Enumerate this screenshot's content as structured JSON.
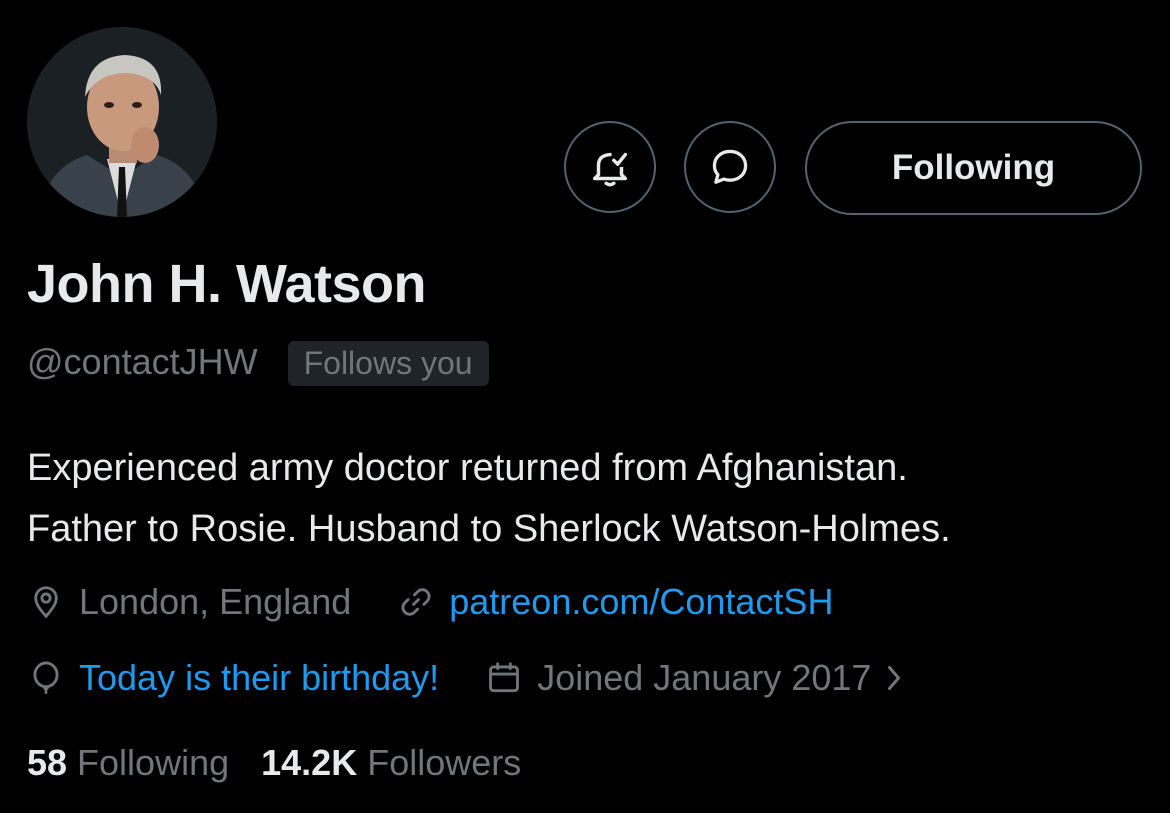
{
  "profile": {
    "display_name": "John H. Watson",
    "handle": "@contactJHW",
    "follows_you_badge": "Follows you",
    "bio_line1": "Experienced army doctor returned from Afghanistan.",
    "bio_line2": "Father to Rosie. Husband to Sherlock Watson-Holmes.",
    "location": "London, England",
    "website": "patreon.com/ContactSH",
    "birthday_text": "Today is their birthday!",
    "joined_text": "Joined January 2017"
  },
  "actions": {
    "notify_icon": "bell-check-icon",
    "message_icon": "message-bubble-icon",
    "following_label": "Following"
  },
  "stats": {
    "following_count": "58",
    "following_label": "Following",
    "followers_count": "14.2K",
    "followers_label": "Followers"
  },
  "colors": {
    "background": "#000000",
    "primary_text": "#e7e9ea",
    "secondary_text": "#71767b",
    "link": "#1d9bf0",
    "border": "#536471"
  }
}
